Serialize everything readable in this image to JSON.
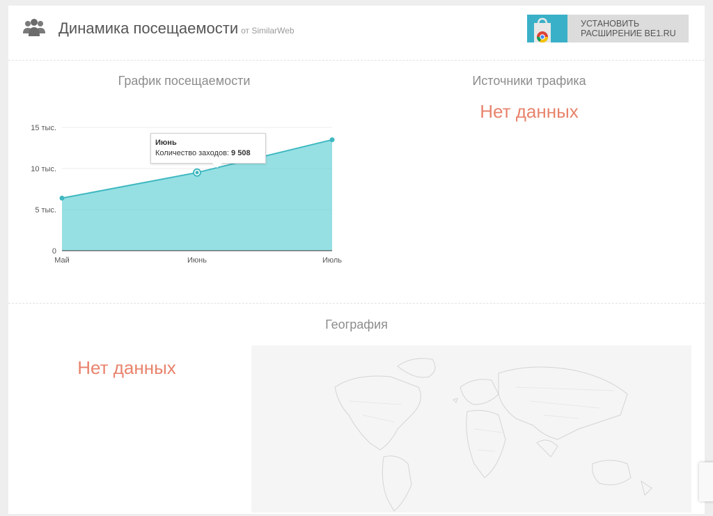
{
  "header": {
    "title": "Динамика посещаемости",
    "source": "от SimilarWeb",
    "install_banner": "УСТАНОВИТЬ РАСШИРЕНИЕ BE1.RU",
    "icon": "users-icon"
  },
  "traffic_chart": {
    "section_title": "График посещаемости",
    "tooltip": {
      "title": "Июнь",
      "label": "Количество заходов:",
      "value": "9 508"
    }
  },
  "chart_data": {
    "type": "area",
    "categories": [
      "Май",
      "Июнь",
      "Июль"
    ],
    "values": [
      6400,
      9508,
      13500
    ],
    "ylim": [
      0,
      15000
    ],
    "yticks": [
      0,
      5000,
      10000,
      15000
    ],
    "ytick_labels": [
      "0",
      "5 тыс.",
      "10 тыс.",
      "15 тыс."
    ],
    "color": "#5ecfd6",
    "line_color": "#3fb8c0",
    "grid": true
  },
  "traffic_sources": {
    "section_title": "Источники трафика",
    "no_data": "Нет данных"
  },
  "geography": {
    "section_title": "География",
    "no_data": "Нет данных"
  }
}
